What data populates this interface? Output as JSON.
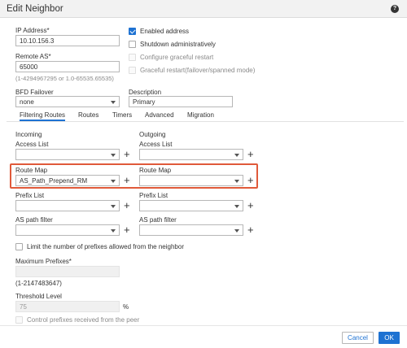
{
  "dialog": {
    "title": "Edit Neighbor",
    "help_icon": "?"
  },
  "general": {
    "ip_address_label": "IP Address*",
    "ip_address_value": "10.10.156.3",
    "remote_as_label": "Remote AS*",
    "remote_as_value": "65000",
    "remote_as_hint": "(1-4294967295 or 1.0-65535.65535)",
    "bfd_label": "BFD Failover",
    "bfd_value": "none",
    "description_label": "Description",
    "description_value": "Primary"
  },
  "options": {
    "enabled_address": {
      "label": "Enabled address",
      "checked": true
    },
    "shutdown": {
      "label": "Shutdown administratively",
      "checked": false
    },
    "graceful_restart": {
      "label": "Configure graceful restart",
      "disabled": true
    },
    "graceful_restart_failover": {
      "label": "Graceful restart(failover/spanned mode)",
      "disabled": true
    }
  },
  "tabs": [
    {
      "label": "Filtering Routes",
      "active": true
    },
    {
      "label": "Routes"
    },
    {
      "label": "Timers"
    },
    {
      "label": "Advanced"
    },
    {
      "label": "Migration"
    }
  ],
  "filtering": {
    "incoming_label": "Incoming",
    "outgoing_label": "Outgoing",
    "access_list_label": "Access List",
    "route_map_label": "Route Map",
    "prefix_list_label": "Prefix List",
    "as_path_filter_label": "AS path filter",
    "incoming_route_map_value": "AS_Path_Prepend_RM",
    "plus": "+"
  },
  "limits": {
    "limit_prefixes_label": "Limit the number of prefixes allowed from the neighbor",
    "max_prefixes_label": "Maximum Prefixes*",
    "max_prefixes_hint": "(1-2147483647)",
    "threshold_label": "Threshold Level",
    "threshold_value": "75",
    "threshold_unit": "%",
    "control_prefixes_label": "Control prefixes received from the peer"
  },
  "footer": {
    "cancel_label": "Cancel",
    "ok_label": "OK"
  },
  "colors": {
    "accent": "#1e72d2",
    "highlight": "#e05a3a"
  }
}
